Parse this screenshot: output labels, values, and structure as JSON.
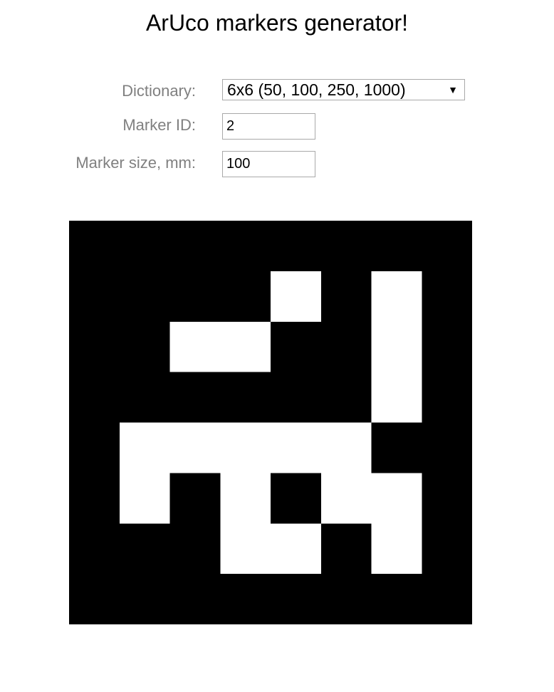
{
  "title": "ArUco markers generator!",
  "form": {
    "dictionary": {
      "label": "Dictionary:",
      "selected": "6x6 (50, 100, 250, 1000)",
      "arrow_icon": "triangle-down-icon"
    },
    "marker_id": {
      "label": "Marker ID:",
      "value": "2"
    },
    "marker_size": {
      "label": "Marker size, mm:",
      "value": "100"
    }
  },
  "marker": {
    "grid_size": 8,
    "foreground": "#000000",
    "background": "#ffffff",
    "bits": [
      [
        0,
        0,
        0,
        0,
        0,
        0,
        0,
        0
      ],
      [
        0,
        0,
        0,
        0,
        1,
        0,
        1,
        0
      ],
      [
        0,
        0,
        1,
        1,
        0,
        0,
        1,
        0
      ],
      [
        0,
        0,
        0,
        0,
        0,
        0,
        1,
        0
      ],
      [
        0,
        1,
        1,
        1,
        1,
        1,
        0,
        0
      ],
      [
        0,
        1,
        0,
        1,
        0,
        1,
        1,
        0
      ],
      [
        0,
        0,
        0,
        1,
        1,
        0,
        1,
        0
      ],
      [
        0,
        0,
        0,
        0,
        0,
        0,
        0,
        0
      ]
    ]
  }
}
